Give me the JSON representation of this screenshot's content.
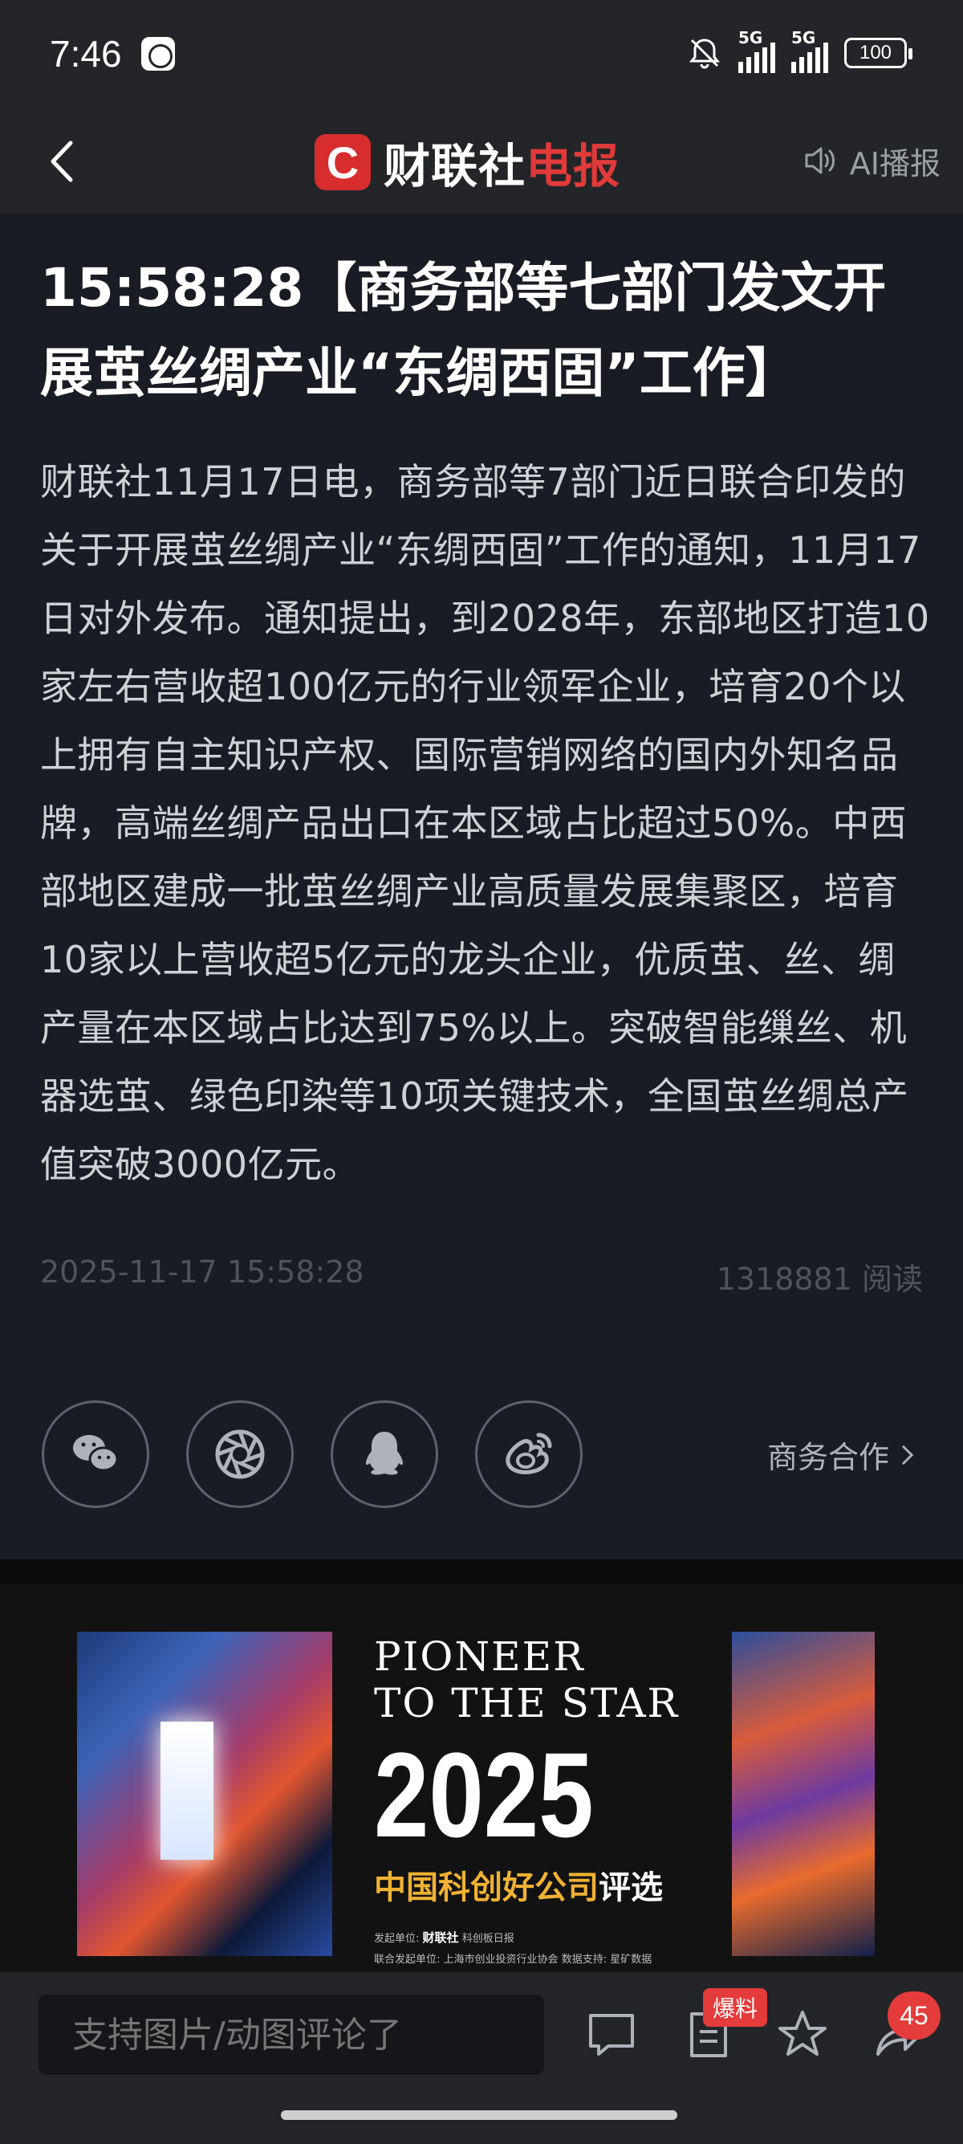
{
  "status_bar": {
    "time": "7:46",
    "network1": "5G",
    "network2": "5G",
    "battery": "100"
  },
  "nav": {
    "brand_logo": "C",
    "brand_part1": "财联社",
    "brand_part2": "电报",
    "ai_label": "AI播报"
  },
  "article": {
    "headline": "15:58:28【商务部等七部门发文开展茧丝绸产业“东绸西固”工作】",
    "body": "财联社11月17日电，商务部等7部门近日联合印发的关于开展茧丝绸产业“东绸西固”工作的通知，11月17日对外发布。通知提出，到2028年，东部地区打造10家左右营收超100亿元的行业领军企业，培育20个以上拥有自主知识产权、国际营销网络的国内外知名品牌，高端丝绸产品出口在本区域占比超过50%。中西部地区建成一批茧丝绸产业高质量发展集聚区，培育10家以上营收超5亿元的龙头企业，优质茧、丝、绸产量在本区域占比达到75%以上。突破智能缫丝、机器选茧、绿色印染等10项关键技术，全国茧丝绸总产值突破3000亿元。",
    "datetime": "2025-11-17 15:58:28",
    "reads": "1318881 阅读",
    "business_label": "商务合作"
  },
  "share": {
    "icons": [
      "wechat-icon",
      "moments-icon",
      "qq-icon",
      "weibo-icon"
    ]
  },
  "banner": {
    "line1": "PIONEER",
    "line2": "TO THE STAR",
    "year": "2025",
    "subtitle_gold": "中国科创好公司",
    "subtitle_white": "评选",
    "foot_line1_label": "发起单位:",
    "foot_line1_org1": "财联社",
    "foot_line1_org2": "科创板日报",
    "foot_line2_label": "联合发起单位:",
    "foot_line2_org": "上海市创业投资行业协会",
    "foot_line2_data_label": "数据支持:",
    "foot_line2_data_org": "星矿数据"
  },
  "bottom_bar": {
    "comment_placeholder": "支持图片/动图评论了",
    "tip_badge": "爆料",
    "share_count": "45"
  },
  "colors": {
    "accent_red": "#e03a3a",
    "background": "#191c25",
    "gold": "#f0b233"
  }
}
